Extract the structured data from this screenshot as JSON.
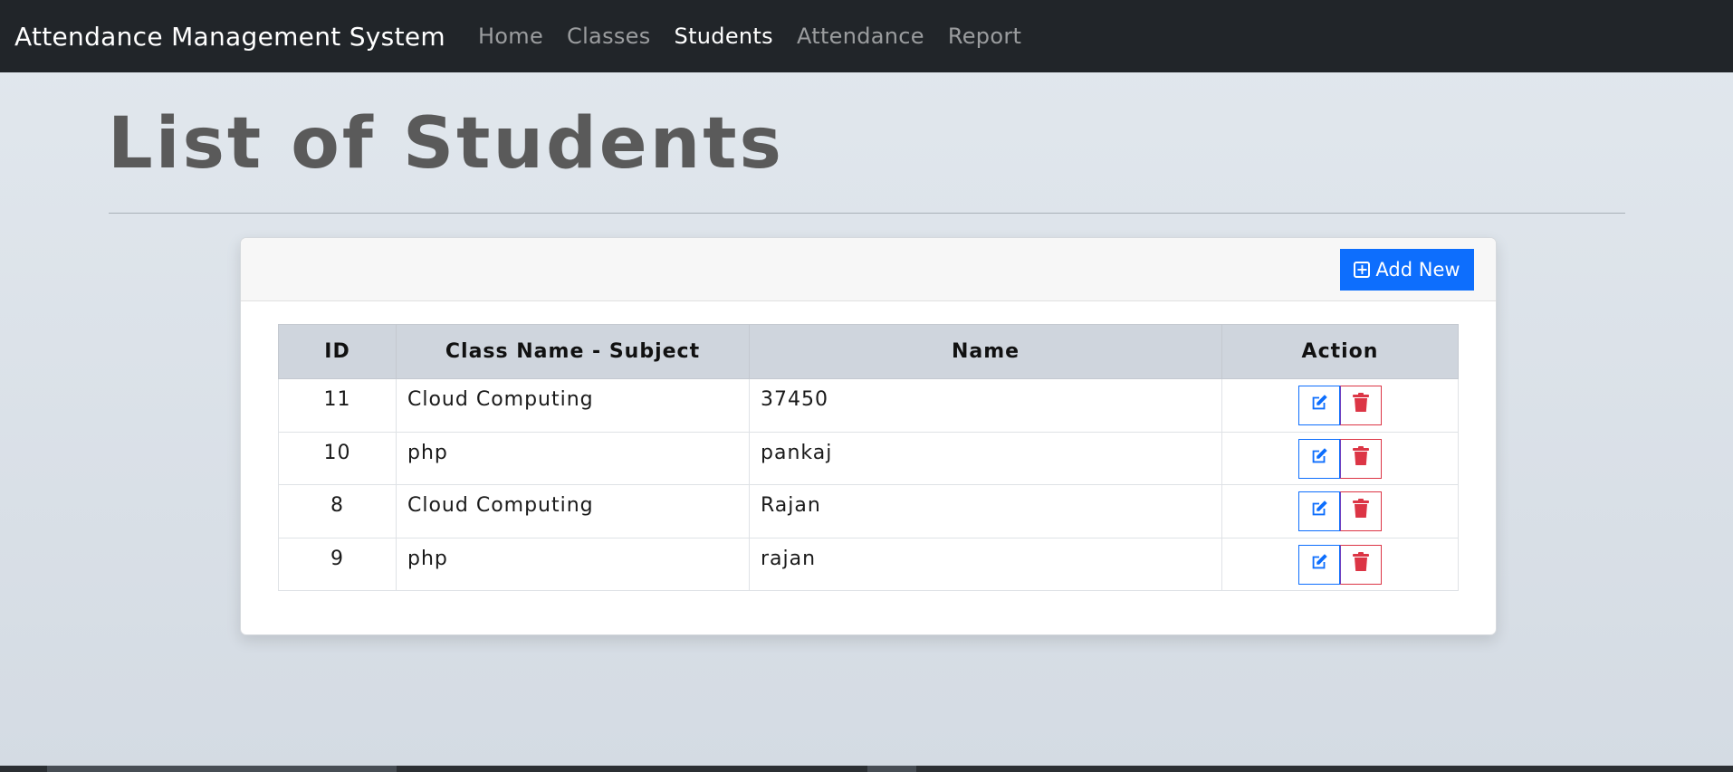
{
  "navbar": {
    "brand": "Attendance Management System",
    "links": [
      {
        "label": "Home",
        "active": false
      },
      {
        "label": "Classes",
        "active": false
      },
      {
        "label": "Students",
        "active": true
      },
      {
        "label": "Attendance",
        "active": false
      },
      {
        "label": "Report",
        "active": false
      }
    ]
  },
  "page": {
    "title": "List of Students"
  },
  "toolbar": {
    "add_label": "Add New"
  },
  "table": {
    "headers": [
      "ID",
      "Class Name - Subject",
      "Name",
      "Action"
    ],
    "rows": [
      {
        "id": "11",
        "class_subject": "Cloud Computing",
        "name": "37450"
      },
      {
        "id": "10",
        "class_subject": "php",
        "name": "pankaj"
      },
      {
        "id": "8",
        "class_subject": "Cloud Computing",
        "name": "Rajan"
      },
      {
        "id": "9",
        "class_subject": "php",
        "name": "rajan"
      }
    ]
  },
  "colors": {
    "navbar_bg": "#212529",
    "primary": "#0d6efd",
    "danger": "#dc3545",
    "header_bg": "#cfd5dd"
  },
  "icons": {
    "add": "plus-square-icon",
    "edit": "edit-icon",
    "delete": "trash-icon"
  }
}
